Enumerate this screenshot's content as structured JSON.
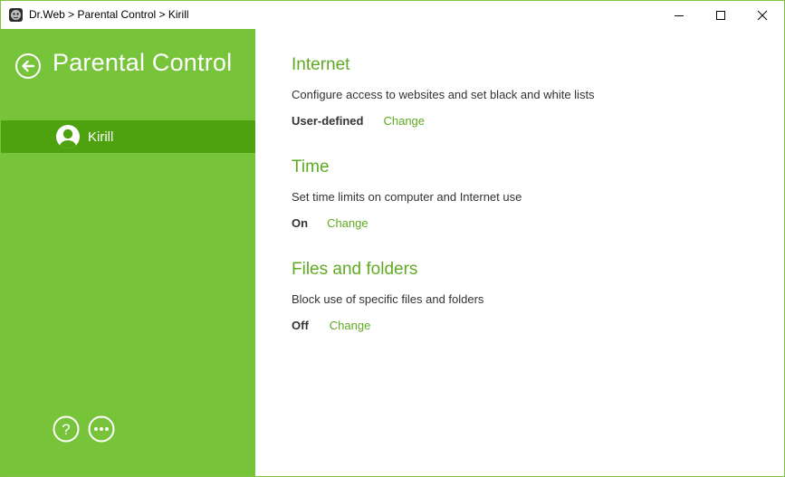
{
  "window": {
    "title": "Dr.Web > Parental Control > Kirill"
  },
  "colors": {
    "sidebar_bg": "#77c33a",
    "sidebar_selected_bg": "#4ea20f",
    "accent_green": "#5faa22",
    "window_border": "#7fc241"
  },
  "titlebar_buttons": {
    "minimize_icon": "minimize-icon",
    "maximize_icon": "maximize-icon",
    "close_icon": "close-icon"
  },
  "sidebar": {
    "back_icon": "back-arrow-icon",
    "title": "Parental Control",
    "users": [
      {
        "name": "Kirill",
        "icon": "user-avatar-icon",
        "selected": true
      }
    ],
    "help_icon": "help-icon",
    "more_icon": "more-options-icon"
  },
  "main": {
    "sections": [
      {
        "title": "Internet",
        "description": "Configure access to websites and set black and white lists",
        "status": "User-defined",
        "action": "Change"
      },
      {
        "title": "Time",
        "description": "Set time limits on computer and Internet use",
        "status": "On",
        "action": "Change"
      },
      {
        "title": "Files and folders",
        "description": "Block use of specific files and folders",
        "status": "Off",
        "action": "Change"
      }
    ]
  }
}
